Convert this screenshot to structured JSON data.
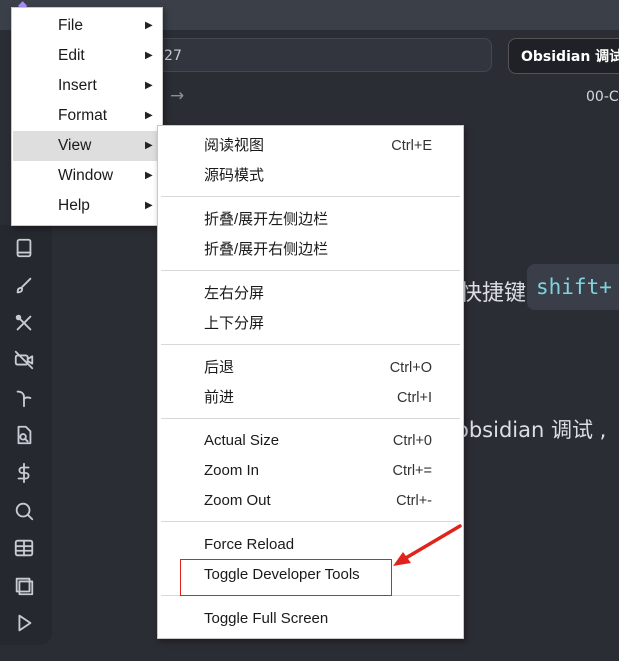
{
  "app": {
    "address_text": "-27",
    "search_label": "Obsidian 调试",
    "doc_date": "00-C",
    "nav_arrow": "→"
  },
  "editor": {
    "shortcut_text": "快捷键",
    "shortcut_code": "shift+",
    "debug_text": "obsidian 调试 ,"
  },
  "ribbon": {
    "icons": [
      "book-icon",
      "brush-icon",
      "tools-icon",
      "video-off-icon",
      "sprout-icon",
      "file-search-icon",
      "dollar-icon",
      "search-icon",
      "table-icon",
      "layers-icon",
      "play-icon"
    ]
  },
  "main_menu": {
    "items": [
      {
        "label": "File",
        "has_submenu": true
      },
      {
        "label": "Edit",
        "has_submenu": true
      },
      {
        "label": "Insert",
        "has_submenu": true
      },
      {
        "label": "Format",
        "has_submenu": true
      },
      {
        "label": "View",
        "has_submenu": true,
        "active": true
      },
      {
        "label": "Window",
        "has_submenu": true
      },
      {
        "label": "Help",
        "has_submenu": true
      }
    ]
  },
  "view_menu": {
    "items": [
      {
        "label": "阅读视图",
        "shortcut": "Ctrl+E"
      },
      {
        "label": "源码模式",
        "shortcut": ""
      },
      {
        "label": "折叠/展开左侧边栏",
        "shortcut": ""
      },
      {
        "label": "折叠/展开右侧边栏",
        "shortcut": ""
      },
      {
        "label": "左右分屏",
        "shortcut": ""
      },
      {
        "label": "上下分屏",
        "shortcut": ""
      },
      {
        "label": "后退",
        "shortcut": "Ctrl+O"
      },
      {
        "label": "前进",
        "shortcut": "Ctrl+I"
      },
      {
        "label": "Actual Size",
        "shortcut": "Ctrl+0"
      },
      {
        "label": "Zoom In",
        "shortcut": "Ctrl+="
      },
      {
        "label": "Zoom Out",
        "shortcut": "Ctrl+-"
      },
      {
        "label": "Force Reload",
        "shortcut": ""
      },
      {
        "label": "Toggle Developer Tools",
        "shortcut": ""
      },
      {
        "label": "Toggle Full Screen",
        "shortcut": ""
      }
    ]
  },
  "annotation": {
    "highlight_color": "#e0241b"
  }
}
